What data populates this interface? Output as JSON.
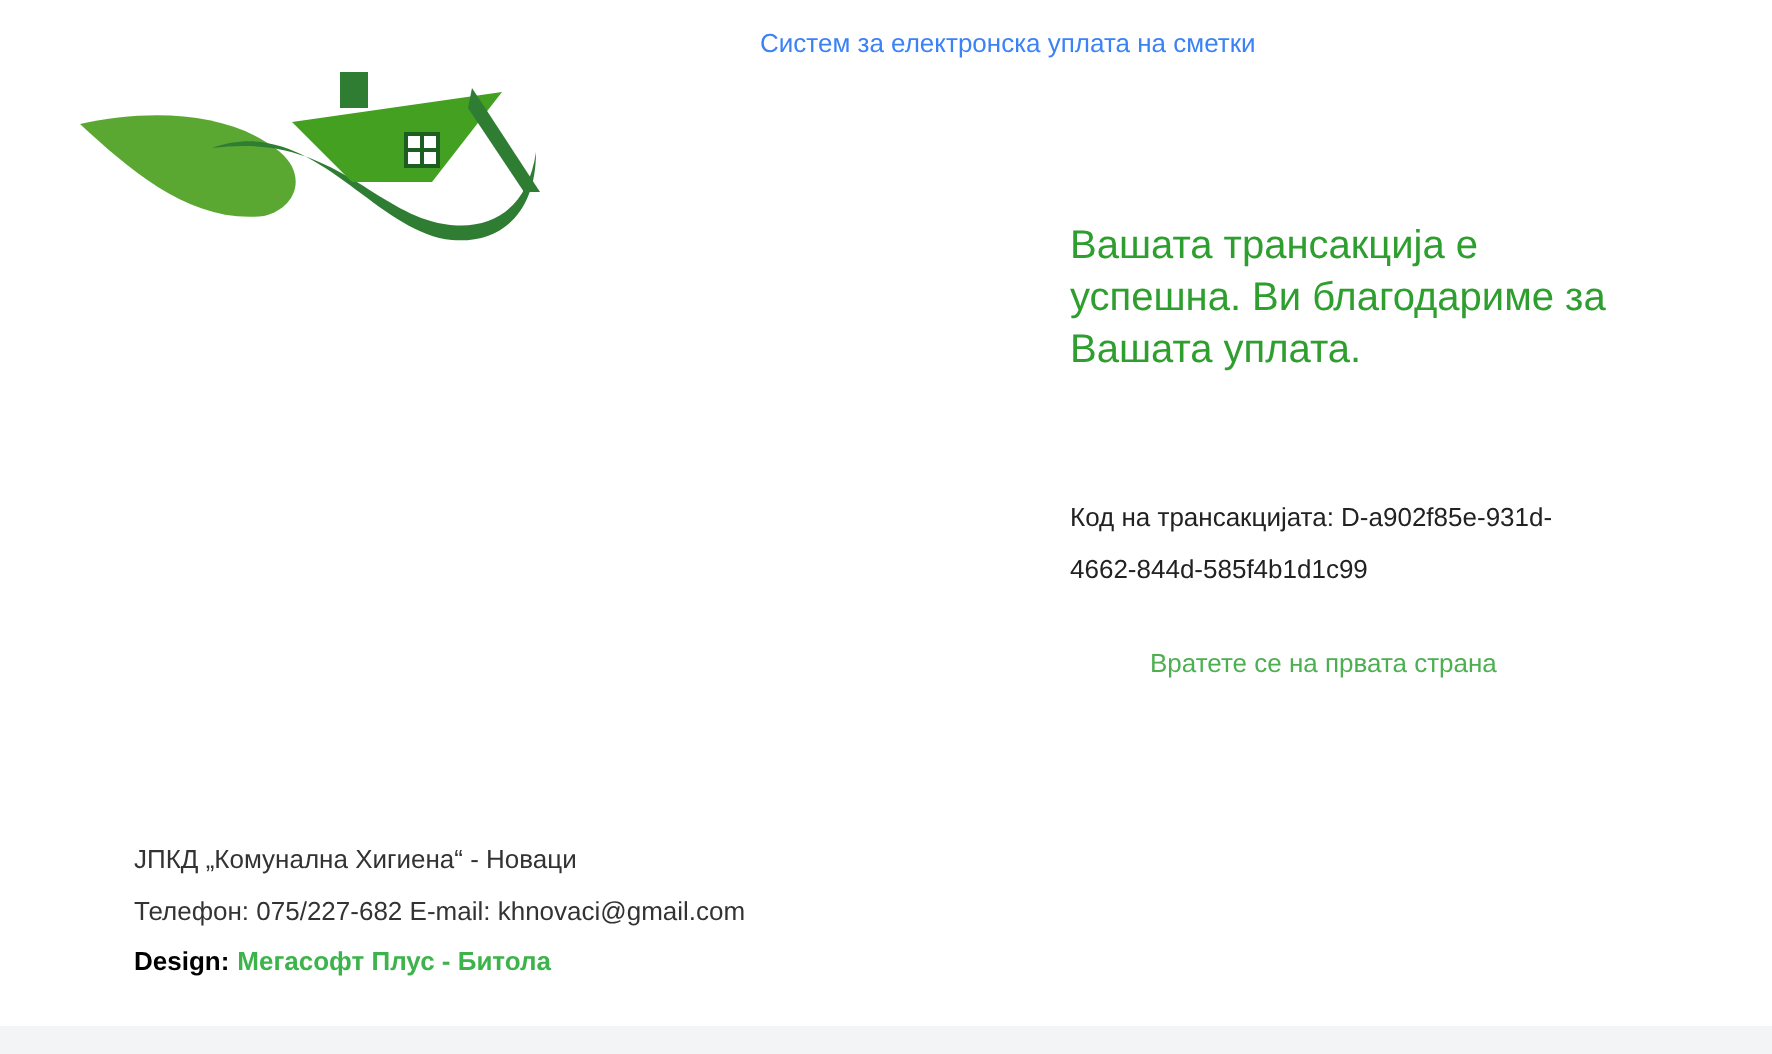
{
  "header": {
    "title": "Систем за електронска уплата на сметки"
  },
  "result": {
    "message": "Вашата трансакција е успешна. Ви благодариме за Вашата уплата.",
    "code": "Код на трансакцијата: D-a902f85e-931d-4662-844d-585f4b1d1c99",
    "back_link": "Вратете се на првата страна"
  },
  "footer": {
    "company": "ЈПКД „Комунална Хигиена“ - Новаци",
    "contact": "Телефон: 075/227-682 E-mail: khnovaci@gmail.com",
    "design_label": "Design:",
    "design_link": "Мегасофт Плус - Битола"
  }
}
